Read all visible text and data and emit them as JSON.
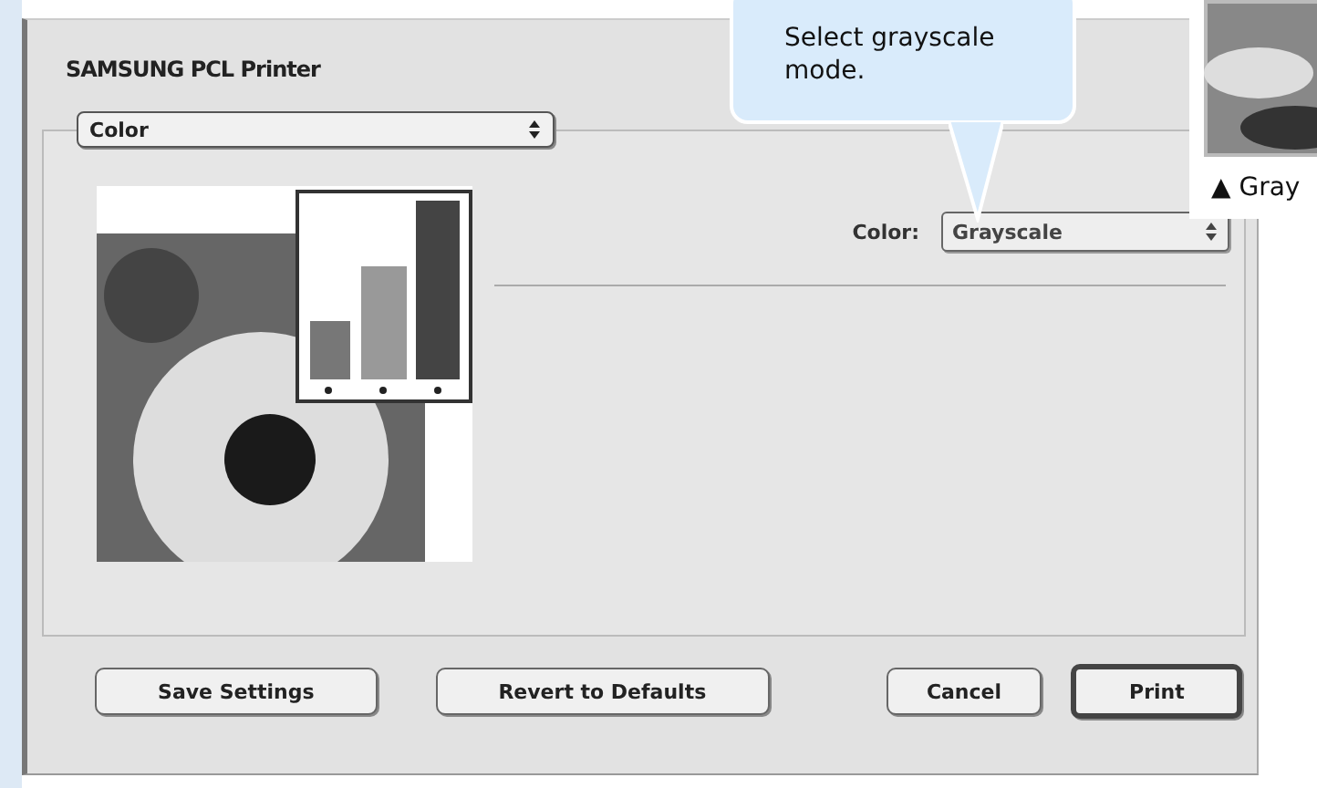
{
  "dialog": {
    "title": "SAMSUNG PCL Printer",
    "panel_menu": {
      "value": "Color"
    },
    "color_setting": {
      "label": "Color:",
      "value": "Grayscale"
    },
    "buttons": [
      {
        "label": "Save Settings",
        "default": false
      },
      {
        "label": "Revert to Defaults",
        "default": false
      },
      {
        "label": "Cancel",
        "default": false
      },
      {
        "label": "Print",
        "default": true
      }
    ]
  },
  "callout": {
    "text": "Select grayscale mode."
  },
  "inset": {
    "caption": "▲ Gray"
  }
}
